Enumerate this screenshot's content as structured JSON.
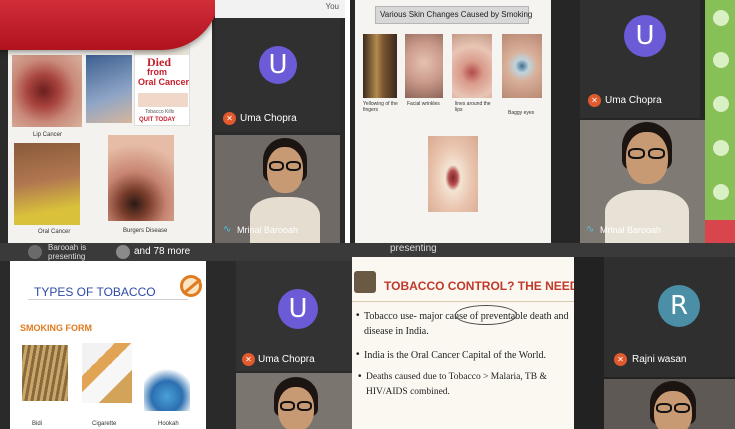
{
  "quad_tl": {
    "header_partial": "You",
    "captions": [
      "Lip Cancer",
      "Oral Cancer",
      "Burgers Disease"
    ],
    "poster_small": "Tobacco Kills",
    "poster_title_line1": "Died",
    "poster_title_line2": "from",
    "poster_title_line3": "Oral Cancer",
    "poster_footer": "QUIT TODAY",
    "participants": [
      {
        "initial": "U",
        "name": "Uma Chopra",
        "avatar_color": "#6b5bd6"
      },
      {
        "name": "Mrinal Barooah"
      }
    ]
  },
  "quad_tr": {
    "slide_title": "Various Skin Changes Caused by Smoking",
    "captions": [
      "Yellowing of the fingers",
      "Facial wrinkles",
      "lines around the lips",
      "Baggy eyes"
    ],
    "participants": [
      {
        "initial": "U",
        "name": "Uma Chopra",
        "avatar_color": "#6b5bd6"
      },
      {
        "name": "Mrinal Barooah"
      }
    ]
  },
  "quad_bl": {
    "presenter_partial": "Barooah is presenting",
    "more_text": "and 78 more",
    "slide_title": "TYPES OF TOBACCO",
    "section_label": "SMOKING FORM",
    "captions": [
      "Bidi",
      "Cigarette",
      "Hookah"
    ],
    "participants": [
      {
        "initial": "U",
        "name": "Uma Chopra",
        "avatar_color": "#6b5bd6"
      }
    ]
  },
  "quad_br": {
    "presenter_partial": "presenting",
    "slide_title": "TOBACCO CONTROL? THE NEED",
    "bullets": [
      "Tobacco use- major cause of preventable death and disease in India.",
      "India is the Oral Cancer Capital of the World.",
      "Deaths caused due to Tobacco > Malaria, TB & HIV/AIDS combined."
    ],
    "participants": [
      {
        "initial": "R",
        "name": "Rajni wasan",
        "avatar_color": "#4b8fa6"
      }
    ]
  },
  "colors": {
    "banner_red": "#c41f2b",
    "slide_red": "#c0392b",
    "slide_orange": "#e07b1f",
    "mic_muted": "#e05a2e",
    "tile_bg": "#2e2e2e"
  },
  "icons": [
    "mic-muted-icon",
    "audio-wave-icon",
    "no-smoking-icon"
  ]
}
